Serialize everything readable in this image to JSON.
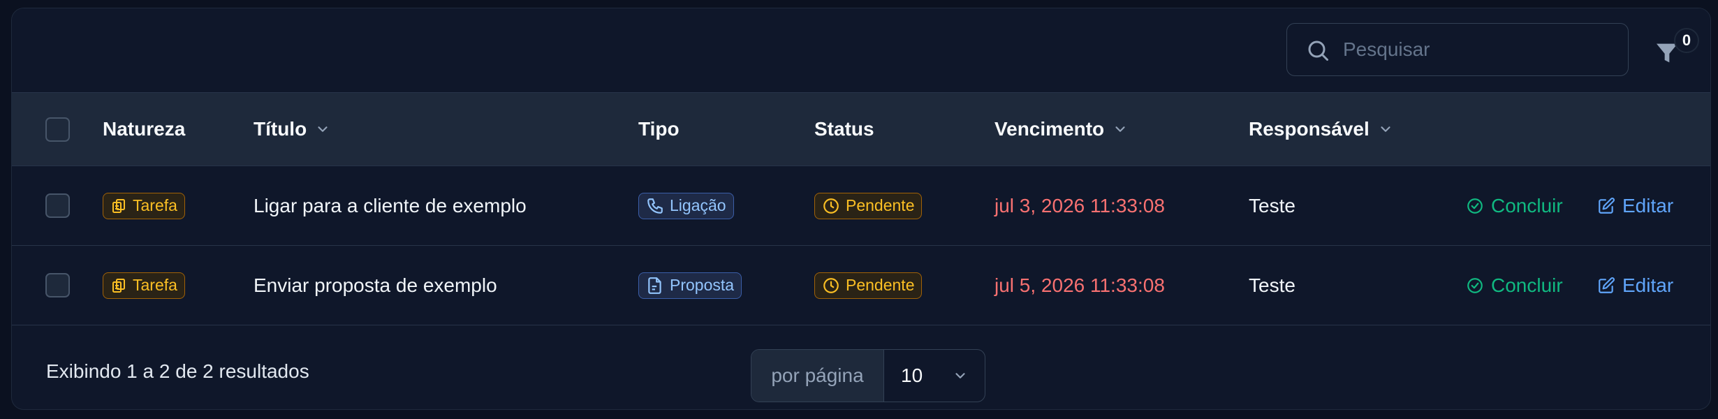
{
  "search": {
    "placeholder": "Pesquisar"
  },
  "filter": {
    "count": "0"
  },
  "columns": {
    "natureza": "Natureza",
    "titulo": "Título",
    "tipo": "Tipo",
    "status": "Status",
    "vencimento": "Vencimento",
    "responsavel": "Responsável"
  },
  "rows": [
    {
      "natureza": "Tarefa",
      "titulo": "Ligar para a cliente de exemplo",
      "tipo": "Ligação",
      "tipo_icon": "phone-icon",
      "status": "Pendente",
      "vencimento": "jul 3, 2026 11:33:08",
      "responsavel": "Teste",
      "concluir": "Concluir",
      "editar": "Editar"
    },
    {
      "natureza": "Tarefa",
      "titulo": "Enviar proposta de exemplo",
      "tipo": "Proposta",
      "tipo_icon": "document-icon",
      "status": "Pendente",
      "vencimento": "jul 5, 2026 11:33:08",
      "responsavel": "Teste",
      "concluir": "Concluir",
      "editar": "Editar"
    }
  ],
  "footer": {
    "results": "Exibindo 1 a 2 de 2 resultados",
    "per_page_label": "por página",
    "per_page_value": "10"
  },
  "colors": {
    "accent_amber": "#fbbf24",
    "accent_blue": "#93c5fd",
    "due_red": "#f87171",
    "success_green": "#10b981",
    "link_blue": "#60a5fa"
  }
}
